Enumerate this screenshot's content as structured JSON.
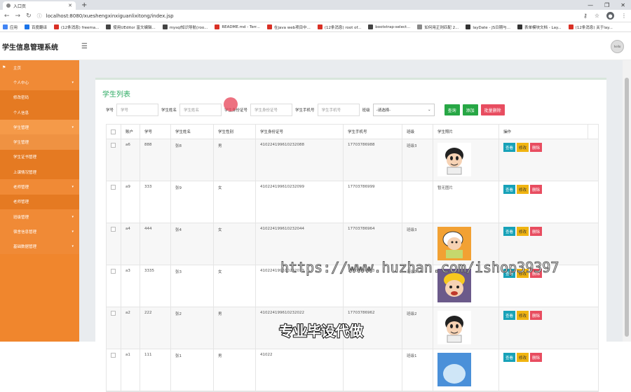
{
  "browser": {
    "tab_title": "入口页",
    "url": "localhost:8080/xueshengxinxiguanlixitong/index.jsp",
    "bookmarks": [
      "应用",
      "百度翻译",
      "(12条消息) freema...",
      "使用UEditor 富文编辑...",
      "mysql知识导航(roo...",
      "README.md - Terr...",
      "在java web项目中...",
      "(12条消息) root of...",
      "bootstrap-select...",
      "如何用正则匹配 2...",
      "layDate - JS日期与...",
      "表单模块文档 - Lay...",
      "(12条消息) 关于lay..."
    ]
  },
  "app": {
    "brand": "学生信息管理系统",
    "user_label": "hello"
  },
  "sidebar": [
    {
      "label": "主页",
      "type": "parent",
      "icon": "flag-icon"
    },
    {
      "label": "个人中心",
      "type": "parent",
      "caret": true
    },
    {
      "label": "修改密码",
      "type": "sub"
    },
    {
      "label": "个人信息",
      "type": "sub"
    },
    {
      "label": "学生管理",
      "type": "parent",
      "caret": true,
      "active": true
    },
    {
      "label": "学生管理",
      "type": "sub",
      "active": true
    },
    {
      "label": "学生证书管理",
      "type": "sub"
    },
    {
      "label": "上课情况管理",
      "type": "sub"
    },
    {
      "label": "老师管理",
      "type": "parent",
      "caret": true
    },
    {
      "label": "老师管理",
      "type": "sub"
    },
    {
      "label": "班级管理",
      "type": "parent",
      "caret": true
    },
    {
      "label": "宿舍信息管理",
      "type": "parent",
      "caret": true
    },
    {
      "label": "基础数据管理",
      "type": "parent",
      "caret": true
    }
  ],
  "page": {
    "title": "学生列表",
    "search": {
      "id_label": "学号",
      "id_placeholder": "学号",
      "name_label": "学生姓名",
      "name_placeholder": "学生姓名",
      "idcard_label": "学生身份证号",
      "idcard_placeholder": "学生身份证号",
      "phone_label": "学生手机号",
      "phone_placeholder": "学生手机号",
      "class_label": "班级",
      "class_value": "-请选择-",
      "query": "查询",
      "add": "添加",
      "batch_delete": "批量删除"
    },
    "columns": [
      "账户",
      "学号",
      "学生姓名",
      "学生性别",
      "学生身份证号",
      "学生手机号",
      "班级",
      "学生照片",
      "操作"
    ],
    "ops": {
      "view": "查看",
      "edit": "修改",
      "delete": "删除"
    },
    "rows": [
      {
        "account": "a6",
        "sid": "888",
        "name": "张8",
        "gender": "男",
        "idcard": "410224199610232088",
        "phone": "17703786988",
        "cls": "班级3",
        "photo": "kid-a",
        "photo_text": ""
      },
      {
        "account": "a9",
        "sid": "333",
        "name": "张9",
        "gender": "女",
        "idcard": "410224199610232099",
        "phone": "17703786999",
        "cls": "",
        "photo": "none",
        "photo_text": "暂无图片"
      },
      {
        "account": "a4",
        "sid": "444",
        "name": "张4",
        "gender": "女",
        "idcard": "410224199610232044",
        "phone": "17703786964",
        "cls": "班级3",
        "photo": "kid-b",
        "photo_text": ""
      },
      {
        "account": "a3",
        "sid": "3335",
        "name": "张3",
        "gender": "女",
        "idcard": "410224199610232033",
        "phone": "17703786933",
        "cls": "班级3",
        "photo": "kid-c",
        "photo_text": ""
      },
      {
        "account": "a2",
        "sid": "222",
        "name": "张2",
        "gender": "男",
        "idcard": "410224199610232022",
        "phone": "17703786962",
        "cls": "班级2",
        "photo": "kid-a",
        "photo_text": ""
      },
      {
        "account": "a1",
        "sid": "111",
        "name": "张1",
        "gender": "男",
        "idcard": "41022",
        "phone": "",
        "cls": "班级1",
        "photo": "kid-d",
        "photo_text": ""
      }
    ]
  },
  "overlay": {
    "watermark": "https://www.huzhan.com/ishop39397",
    "caption": "专业毕设代做"
  },
  "colors": {
    "sidebar": "#f0862d",
    "title": "#2aaa60",
    "view": "#17a2b8",
    "edit": "#f0b411",
    "delete": "#e84d60"
  }
}
